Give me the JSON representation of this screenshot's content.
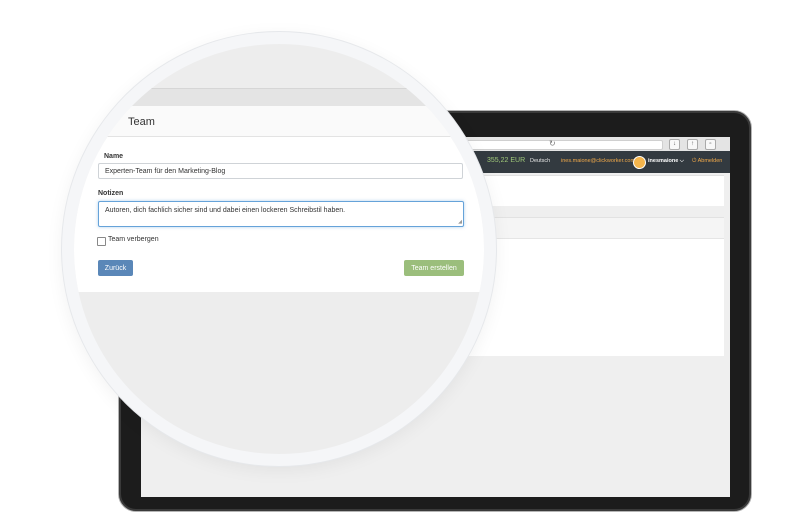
{
  "app_bar": {
    "balance": "355,22 EUR",
    "language": "Deutsch",
    "email": "ines.maione@clickworker.com",
    "username": "inesmaione",
    "username_caret": "⌵",
    "logout": "Abmelden",
    "logout_icon": "power-icon"
  },
  "modal": {
    "title": "Team",
    "name_label": "Name",
    "name_value": "Experten-Team für den Marketing-Blog",
    "notes_label": "Notizen",
    "notes_value": "Autoren, dich fachlich sicher sind und dabei einen lockeren Schreibstil haben.",
    "hide_label": "Team verbergen",
    "back_label": "Zurück",
    "create_label": "Team erstellen"
  },
  "colors": {
    "appbar_bg": "#333a40",
    "balance": "#9fc879",
    "accent_orange": "#f0a94a",
    "back_button": "#5a87b8",
    "create_button": "#9bbe7c",
    "focus_border": "#66a3d9"
  }
}
